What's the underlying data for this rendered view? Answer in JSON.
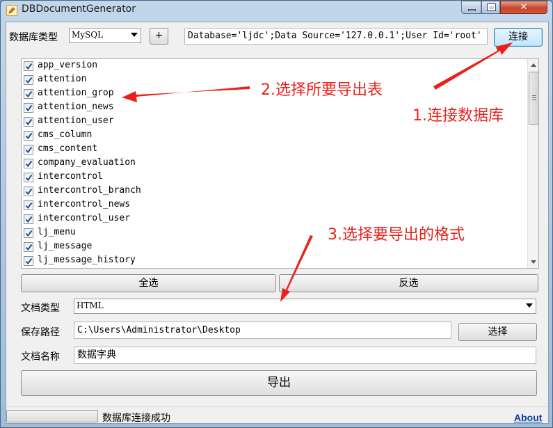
{
  "window": {
    "title": "DBDocumentGenerator"
  },
  "connection": {
    "db_type_label": "数据库类型",
    "db_type_value": "MySQL",
    "add_button": "+",
    "connection_string": "Database='ljdc';Data Source='127.0.0.1';User Id='root'",
    "connect_button": "连接"
  },
  "tables": {
    "items": [
      {
        "name": "app_version",
        "checked": true
      },
      {
        "name": "attention",
        "checked": true
      },
      {
        "name": "attention_grop",
        "checked": true
      },
      {
        "name": "attention_news",
        "checked": true
      },
      {
        "name": "attention_user",
        "checked": true
      },
      {
        "name": "cms_column",
        "checked": true
      },
      {
        "name": "cms_content",
        "checked": true
      },
      {
        "name": "company_evaluation",
        "checked": true
      },
      {
        "name": "intercontrol",
        "checked": true
      },
      {
        "name": "intercontrol_branch",
        "checked": true
      },
      {
        "name": "intercontrol_news",
        "checked": true
      },
      {
        "name": "intercontrol_user",
        "checked": true
      },
      {
        "name": "lj_menu",
        "checked": true
      },
      {
        "name": "lj_message",
        "checked": true
      },
      {
        "name": "lj_message_history",
        "checked": true
      }
    ],
    "select_all_button": "全选",
    "invert_button": "反选"
  },
  "export": {
    "doc_type_label": "文档类型",
    "doc_type_value": "HTML",
    "save_path_label": "保存路径",
    "save_path_value": "C:\\Users\\Administrator\\Desktop",
    "browse_button": "选择",
    "doc_name_label": "文档名称",
    "doc_name_value": "数据字典",
    "export_button": "导出"
  },
  "statusbar": {
    "status_text": "数据库连接成功",
    "about_link": "About"
  },
  "annotations": {
    "step1": "1.连接数据库",
    "step2": "2.选择所要导出表",
    "step3": "3.选择要导出的格式",
    "color": "#e8211b"
  }
}
